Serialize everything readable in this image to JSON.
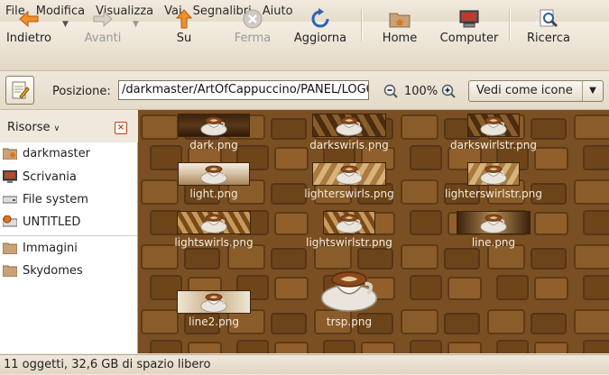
{
  "menubar": {
    "items": [
      "File",
      "Modifica",
      "Visualizza",
      "Vai",
      "Segnalibri",
      "Aiuto"
    ]
  },
  "toolbar": {
    "back": "Indietro",
    "forward": "Avanti",
    "up": "Su",
    "stop": "Ferma",
    "reload": "Aggiorna",
    "home": "Home",
    "computer": "Computer",
    "search": "Ricerca"
  },
  "location": {
    "label": "Posizione:",
    "path": "/darkmaster/ArtOfCappuccino/PANEL/LOGO",
    "zoom": "100%",
    "view_mode": "Vedi come icone"
  },
  "sidebar": {
    "title": "Risorse",
    "places": [
      "darkmaster",
      "Scrivania",
      "File system",
      "UNTITLED"
    ],
    "bookmarks": [
      "Immagini",
      "Skydomes"
    ]
  },
  "files": [
    {
      "name": "dark.png",
      "style": "dark"
    },
    {
      "name": "darkswirls.png",
      "style": "darkswirl"
    },
    {
      "name": "darkswirlstr.png",
      "style": "darkswirl"
    },
    {
      "name": "light.png",
      "style": "light"
    },
    {
      "name": "lighterswirls.png",
      "style": "lightswirl"
    },
    {
      "name": "lighterswirlstr.png",
      "style": "lightswirl"
    },
    {
      "name": "lightswirls.png",
      "style": "midswirl"
    },
    {
      "name": "lightswirlstr.png",
      "style": "midswirl"
    },
    {
      "name": "line.png",
      "style": "line"
    },
    {
      "name": "line2.png",
      "style": "line2"
    },
    {
      "name": "trsp.png",
      "style": "cup"
    }
  ],
  "status": "11 oggetti, 32,6 GB di spazio libero",
  "colors": {
    "background": "#7a4f22",
    "accent": "#e0751c"
  }
}
